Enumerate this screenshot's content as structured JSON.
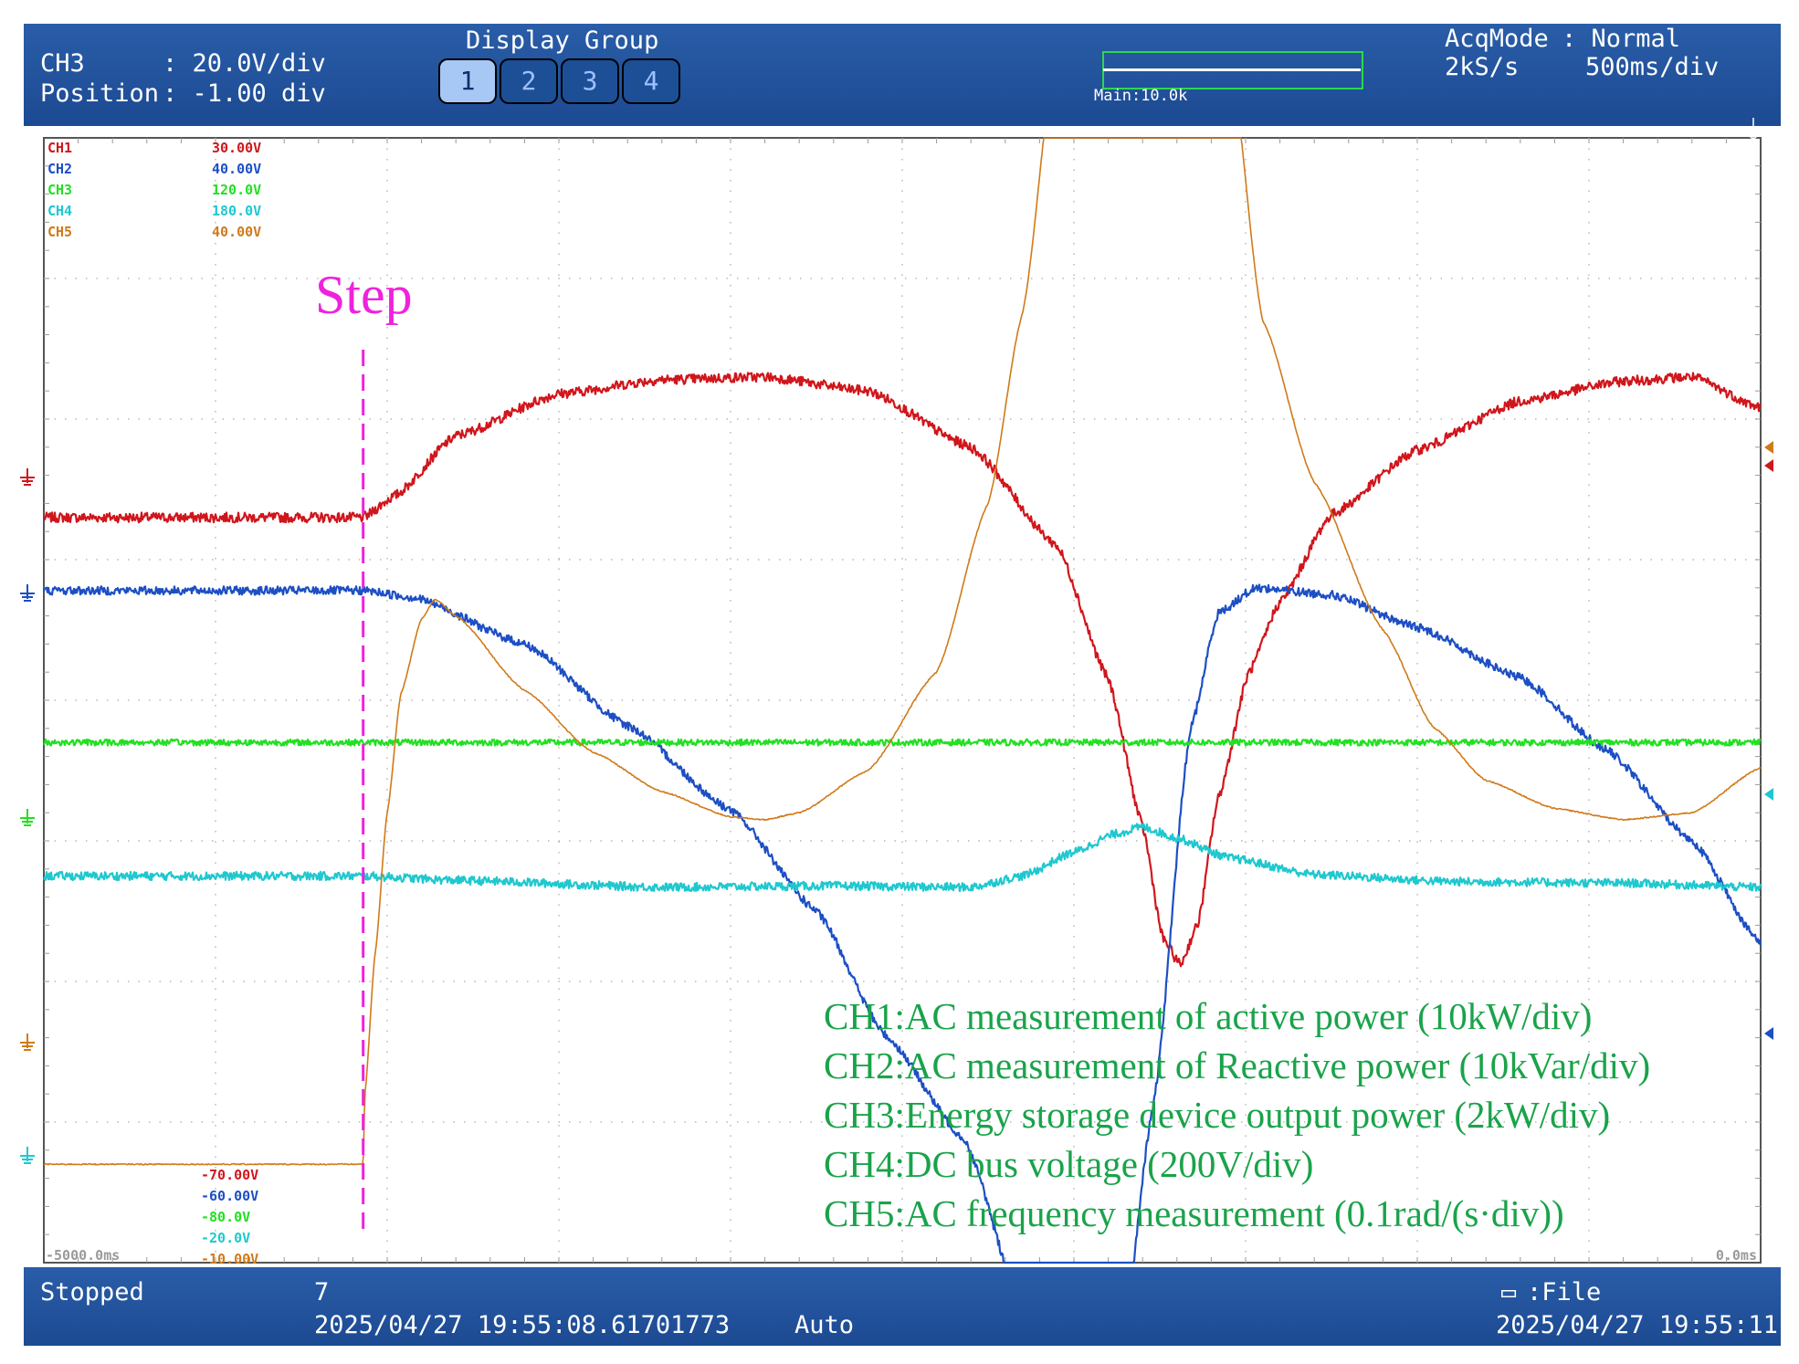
{
  "header": {
    "ch_label": "CH3",
    "ch_scale": ": 20.0V/div",
    "position_label": "Position",
    "position_value": ": -1.00 div",
    "display_group_title": "Display Group",
    "display_group_buttons": [
      "1",
      "2",
      "3",
      "4"
    ],
    "active_group": "1",
    "zoom_label": "Main:10.0k",
    "acq_mode_label": "AcqMode",
    "acq_mode_value": ": Normal",
    "sample_rate": "2kS/s",
    "timebase": "500ms/div"
  },
  "footer": {
    "status": "Stopped",
    "count": "7",
    "trigger_time": "2025/04/27 19:55:08.61701773",
    "trigger_mode": "Auto",
    "save_target": ":File",
    "save_time": "2025/04/27 19:55:11"
  },
  "colors": {
    "ch1": "#d0161c",
    "ch2": "#1d4fc4",
    "ch3": "#22e022",
    "ch4": "#1fc8cf",
    "ch5": "#d07a1a",
    "step": "#ee22dd",
    "annotation": "#1aa34a",
    "grid": "#b8b8b8"
  },
  "chart_data": {
    "type": "line",
    "xlim": [
      -5000,
      0
    ],
    "x_unit": "ms",
    "ylim_div": [
      -4,
      4
    ],
    "x_tick_labels": [
      "-5000.0ms",
      "0.0ms"
    ],
    "step_label": "Step",
    "step_time_ms": -4070,
    "channel_scale_top": [
      {
        "channel": "CH1",
        "value": "30.00V"
      },
      {
        "channel": "CH2",
        "value": "40.00V"
      },
      {
        "channel": "CH3",
        "value": "120.0V"
      },
      {
        "channel": "CH4",
        "value": "180.0V"
      },
      {
        "channel": "CH5",
        "value": "40.00V"
      }
    ],
    "channel_scale_bottom": [
      "-70.00V",
      "-60.00V",
      "-80.0V",
      "-20.0V",
      "-10.00V"
    ],
    "annotations": [
      "CH1:AC measurement of active power (10kW/div)",
      "CH2:AC measurement of Reactive power (10kVar/div)",
      "CH3:Energy storage device output power (2kW/div)",
      "CH4:DC bus voltage (200V/div)",
      "CH5:AC frequency measurement (0.1rad/(s·div))"
    ],
    "series": [
      {
        "channel": "CH1",
        "color_key": "ch1",
        "noise": 0.035,
        "points": [
          [
            -5000,
            1.3
          ],
          [
            -4070,
            1.3
          ],
          [
            -3980,
            1.45
          ],
          [
            -3800,
            1.88
          ],
          [
            -3500,
            2.18
          ],
          [
            -3200,
            2.28
          ],
          [
            -2900,
            2.3
          ],
          [
            -2600,
            2.2
          ],
          [
            -2300,
            1.8
          ],
          [
            -2050,
            1.1
          ],
          [
            -1900,
            0.15
          ],
          [
            -1800,
            -0.9
          ],
          [
            -1740,
            -1.7
          ],
          [
            -1690,
            -1.88
          ],
          [
            -1640,
            -1.6
          ],
          [
            -1580,
            -0.7
          ],
          [
            -1490,
            0.2
          ],
          [
            -1400,
            0.7
          ],
          [
            -1250,
            1.32
          ],
          [
            -1000,
            1.78
          ],
          [
            -700,
            2.13
          ],
          [
            -400,
            2.27
          ],
          [
            -200,
            2.3
          ],
          [
            0,
            2.08
          ]
        ]
      },
      {
        "channel": "CH2",
        "color_key": "ch2",
        "noise": 0.03,
        "points": [
          [
            -5000,
            0.78
          ],
          [
            -4070,
            0.78
          ],
          [
            -3920,
            0.73
          ],
          [
            -3600,
            0.4
          ],
          [
            -3300,
            -0.18
          ],
          [
            -3000,
            -0.78
          ],
          [
            -2750,
            -1.5
          ],
          [
            -2550,
            -2.38
          ],
          [
            -2320,
            -3.12
          ],
          [
            -2150,
            -4.33
          ],
          [
            -2020,
            -5.35
          ],
          [
            -1950,
            -5.45
          ],
          [
            -1880,
            -5.1
          ],
          [
            -1770,
            -2.9
          ],
          [
            -1660,
            -0.2
          ],
          [
            -1580,
            0.62
          ],
          [
            -1470,
            0.8
          ],
          [
            -1250,
            0.75
          ],
          [
            -1000,
            0.52
          ],
          [
            -700,
            0.16
          ],
          [
            -450,
            -0.35
          ],
          [
            -200,
            -1.0
          ],
          [
            0,
            -1.73
          ]
        ]
      },
      {
        "channel": "CH3",
        "color_key": "ch3",
        "noise": 0.022,
        "points": [
          [
            -5000,
            -0.3
          ],
          [
            0,
            -0.3
          ]
        ]
      },
      {
        "channel": "CH4",
        "color_key": "ch4",
        "noise": 0.03,
        "points": [
          [
            -5000,
            -1.25
          ],
          [
            -4070,
            -1.25
          ],
          [
            -3800,
            -1.28
          ],
          [
            -3200,
            -1.33
          ],
          [
            -2700,
            -1.32
          ],
          [
            -2300,
            -1.33
          ],
          [
            -2150,
            -1.25
          ],
          [
            -2000,
            -1.08
          ],
          [
            -1880,
            -0.95
          ],
          [
            -1800,
            -0.9
          ],
          [
            -1700,
            -0.98
          ],
          [
            -1550,
            -1.12
          ],
          [
            -1300,
            -1.24
          ],
          [
            -900,
            -1.29
          ],
          [
            -400,
            -1.3
          ],
          [
            0,
            -1.33
          ]
        ]
      },
      {
        "channel": "CH5",
        "color_key": "ch5",
        "noise": 0.004,
        "points": [
          [
            -5000,
            -3.3
          ],
          [
            -4070,
            -3.3
          ],
          [
            -4065,
            -2.8
          ],
          [
            -4035,
            -1.8
          ],
          [
            -4000,
            -0.8
          ],
          [
            -3960,
            0.05
          ],
          [
            -3900,
            0.58
          ],
          [
            -3860,
            0.72
          ],
          [
            -3800,
            0.6
          ],
          [
            -3600,
            0.07
          ],
          [
            -3400,
            -0.37
          ],
          [
            -3200,
            -0.65
          ],
          [
            -3000,
            -0.83
          ],
          [
            -2900,
            -0.85
          ],
          [
            -2800,
            -0.8
          ],
          [
            -2600,
            -0.5
          ],
          [
            -2400,
            0.2
          ],
          [
            -2250,
            1.4
          ],
          [
            -2150,
            2.75
          ],
          [
            -2050,
            4.7
          ],
          [
            -1810,
            6.5
          ],
          [
            -1550,
            4.7
          ],
          [
            -1450,
            2.7
          ],
          [
            -1300,
            1.55
          ],
          [
            -1100,
            0.5
          ],
          [
            -950,
            -0.2
          ],
          [
            -800,
            -0.57
          ],
          [
            -600,
            -0.77
          ],
          [
            -400,
            -0.85
          ],
          [
            -200,
            -0.8
          ],
          [
            0,
            -0.48
          ]
        ]
      }
    ]
  }
}
